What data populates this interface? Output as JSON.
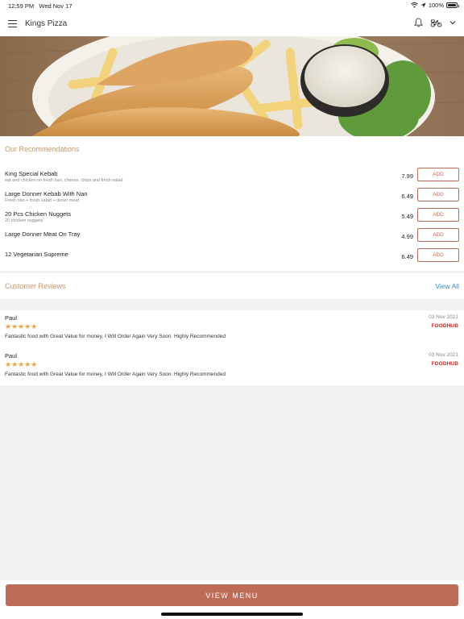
{
  "status_bar": {
    "time": "12:59 PM",
    "date": "Wed Nov 17",
    "battery": "100%",
    "battery_level": 1.0,
    "icons": [
      "wifi-icon",
      "location-arrow-icon",
      "battery-icon"
    ]
  },
  "header": {
    "title": "Kings Pizza",
    "icons": [
      "menu-icon",
      "bell-icon",
      "scooter-icon",
      "chevron-down-icon"
    ]
  },
  "recommendations": {
    "title": "Our Recommendations",
    "add_label": "ADD",
    "items": [
      {
        "name": "King Special Kebab",
        "description": "eat and chicken on fresh nan, cheese, chips and fresh salad",
        "price": "7.99"
      },
      {
        "name": "Large Donner Kebab With Nan",
        "description": "Fresh nan + fresh salad + doner meat",
        "price": "6.49"
      },
      {
        "name": "20 Pcs Chicken Nuggets",
        "description": "20 chicken nuggets",
        "price": "5.49"
      },
      {
        "name": "Large Donner Meat On Tray",
        "description": "",
        "price": "4.99"
      },
      {
        "name": "12 Vegetarian Supreme",
        "description": "",
        "price": "6.49"
      }
    ]
  },
  "reviews": {
    "title": "Customer Reviews",
    "view_all": "View All",
    "items": [
      {
        "author": "Paul",
        "date": "03 Nov 2021",
        "stars": "★★★★★",
        "rating": 5,
        "source": "FOODHUB",
        "text": "Fantastic food with Great Value for money, I Will Order Again Very Soon. Highly Recommended"
      },
      {
        "author": "Paul",
        "date": "03 Nov 2021",
        "stars": "★★★★★",
        "rating": 5,
        "source": "FOODHUB",
        "text": "Fantastic food with Great Value for money, I Will Order Again Very Soon. Highly Recommended"
      }
    ]
  },
  "cta": {
    "label": "VIEW MENU"
  },
  "colors": {
    "accent": "#bd6c5a",
    "section_title": "#c09a6a",
    "link": "#3a8db8",
    "star": "#f0a13a",
    "foodhub": "#d02a2a",
    "background": "#f1f1f1"
  }
}
